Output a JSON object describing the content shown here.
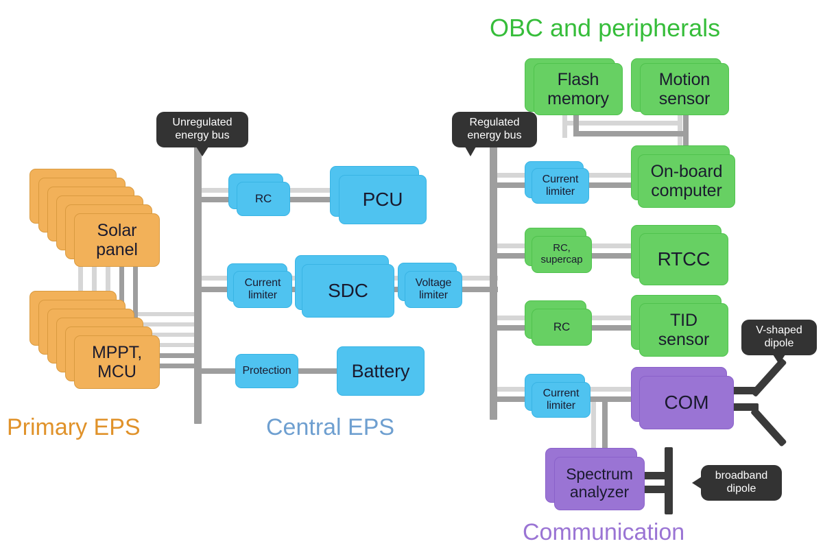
{
  "sections": [
    {
      "id": "primary-eps",
      "label": "Primary EPS",
      "color": "#e0922a"
    },
    {
      "id": "central-eps",
      "label": "Central EPS",
      "color": "#6e9fd0"
    },
    {
      "id": "obc",
      "label": "OBC and peripherals",
      "color": "#36bd3a"
    },
    {
      "id": "communication",
      "label": "Communication",
      "color": "#9a74d4"
    }
  ],
  "callouts": {
    "unregulated_bus": "Unregulated\nenergy bus",
    "unregulated_bus_l1": "Unregulated",
    "unregulated_bus_l2": "energy bus",
    "regulated_bus_l1": "Regulated",
    "regulated_bus_l2": "energy bus",
    "v_dipole_l1": "V-shaped",
    "v_dipole_l2": "dipole",
    "broadband_l1": "broadband",
    "broadband_l2": "dipole"
  },
  "nodes": {
    "solar_panel_l1": "Solar",
    "solar_panel_l2": "panel",
    "mppt_l1": "MPPT,",
    "mppt_l2": "MCU",
    "rc_top": "RC",
    "pcu": "PCU",
    "current_limiter_central": "Current",
    "current_limiter_central2": "limiter",
    "sdc": "SDC",
    "voltage_limiter_l1": "Voltage",
    "voltage_limiter_l2": "limiter",
    "protection": "Protection",
    "battery": "Battery",
    "flash_l1": "Flash",
    "flash_l2": "memory",
    "motion_l1": "Motion",
    "motion_l2": "sensor",
    "cl_obc_l1": "Current",
    "cl_obc_l2": "limiter",
    "obc_l1": "On-board",
    "obc_l2": "computer",
    "rc_supercap_l1": "RC,",
    "rc_supercap_l2": "supercap",
    "rtcc": "RTCC",
    "rc_tid": "RC",
    "tid_l1": "TID",
    "tid_l2": "sensor",
    "cl_com_l1": "Current",
    "cl_com_l2": "limiter",
    "com": "COM",
    "spectrum_l1": "Spectrum",
    "spectrum_l2": "analyzer"
  },
  "colors": {
    "orange": "#f2b159",
    "blue": "#4fc3f0",
    "green": "#67d063",
    "purple": "#9a74d4",
    "wire": "#9e9e9e",
    "wire_light": "#d6d6d6",
    "callout_bg": "#333333",
    "antenna": "#3a3a3a",
    "background": "#ffffff"
  }
}
